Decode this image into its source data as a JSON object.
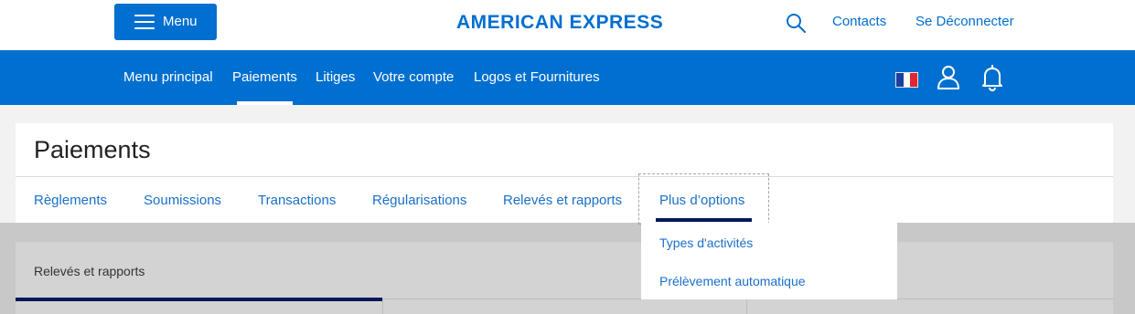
{
  "header": {
    "menu_label": "Menu",
    "brand": "AMERICAN EXPRESS",
    "contacts": "Contacts",
    "logout": "Se Déconnecter"
  },
  "nav": {
    "items": [
      "Menu principal",
      "Paiements",
      "Litiges",
      "Votre compte",
      "Logos et Fournitures"
    ],
    "active": "Paiements"
  },
  "page": {
    "title": "Paiements",
    "tabs": [
      "Règlements",
      "Soumissions",
      "Transactions",
      "Régularisations",
      "Relevés et rapports",
      "Plus d’options"
    ],
    "active_tab": "Plus d’options"
  },
  "dropdown": {
    "items": [
      "Types d'activités",
      "Prélèvement automatique"
    ]
  },
  "section": {
    "title": "Relevés et rapports"
  },
  "colors": {
    "brand_blue": "#006fcf",
    "link_blue": "#1a6fc9",
    "dark_navy": "#00175a"
  }
}
